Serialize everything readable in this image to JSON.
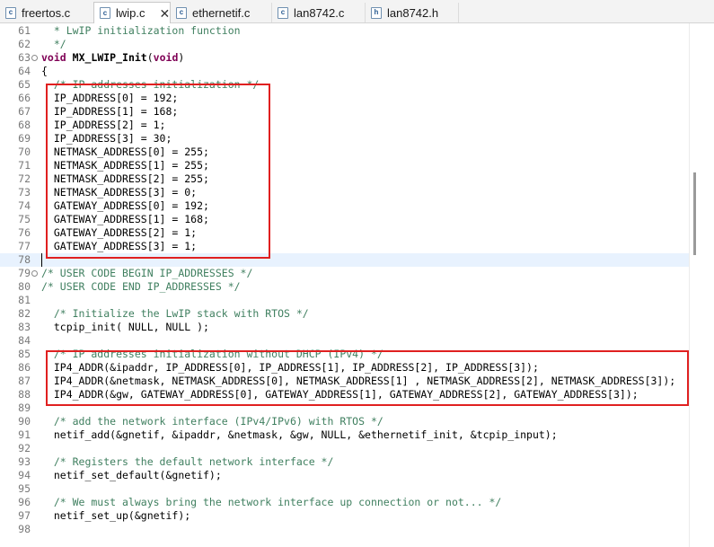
{
  "tabs": [
    {
      "label": "freertos.c",
      "icon": "c-file-icon",
      "active": false
    },
    {
      "label": "lwip.c",
      "icon": "c-file-icon",
      "active": true
    },
    {
      "label": "ethernetif.c",
      "icon": "c-file-icon",
      "active": false
    },
    {
      "label": "lan8742.c",
      "icon": "c-file-icon",
      "active": false
    },
    {
      "label": "lan8742.h",
      "icon": "h-file-icon",
      "active": false
    }
  ],
  "tab_close_glyph": "✕",
  "file_icon_letters": {
    "c": "c",
    "h": "h"
  },
  "colors": {
    "keyword": "#7f0055",
    "comment": "#3f7f5f",
    "highlight_box": "#e02020",
    "current_line": "#e8f2fe"
  },
  "editor": {
    "current_line": 78,
    "lines": [
      {
        "num": "61",
        "segs": [
          {
            "t": "  * LwIP initialization function",
            "c": "cm"
          }
        ]
      },
      {
        "num": "62",
        "segs": [
          {
            "t": "  */",
            "c": "cm"
          }
        ]
      },
      {
        "num": "63",
        "fold": true,
        "segs": [
          {
            "t": "void",
            "c": "kw"
          },
          {
            "t": " ",
            "c": ""
          },
          {
            "t": "MX_LWIP_Init",
            "c": "fn"
          },
          {
            "t": "(",
            "c": ""
          },
          {
            "t": "void",
            "c": "kw"
          },
          {
            "t": ")",
            "c": ""
          }
        ]
      },
      {
        "num": "64",
        "segs": [
          {
            "t": "{",
            "c": ""
          }
        ]
      },
      {
        "num": "65",
        "segs": [
          {
            "t": "  /* IP addresses initialization */",
            "c": "cm"
          }
        ]
      },
      {
        "num": "66",
        "segs": [
          {
            "t": "  IP_ADDRESS[0] = 192;",
            "c": ""
          }
        ]
      },
      {
        "num": "67",
        "segs": [
          {
            "t": "  IP_ADDRESS[1] = 168;",
            "c": ""
          }
        ]
      },
      {
        "num": "68",
        "segs": [
          {
            "t": "  IP_ADDRESS[2] = 1;",
            "c": ""
          }
        ]
      },
      {
        "num": "69",
        "segs": [
          {
            "t": "  IP_ADDRESS[3] = 30;",
            "c": ""
          }
        ]
      },
      {
        "num": "70",
        "segs": [
          {
            "t": "  NETMASK_ADDRESS[0] = 255;",
            "c": ""
          }
        ]
      },
      {
        "num": "71",
        "segs": [
          {
            "t": "  NETMASK_ADDRESS[1] = 255;",
            "c": ""
          }
        ]
      },
      {
        "num": "72",
        "segs": [
          {
            "t": "  NETMASK_ADDRESS[2] = 255;",
            "c": ""
          }
        ]
      },
      {
        "num": "73",
        "segs": [
          {
            "t": "  NETMASK_ADDRESS[3] = 0;",
            "c": ""
          }
        ]
      },
      {
        "num": "74",
        "segs": [
          {
            "t": "  GATEWAY_ADDRESS[0] = 192;",
            "c": ""
          }
        ]
      },
      {
        "num": "75",
        "segs": [
          {
            "t": "  GATEWAY_ADDRESS[1] = 168;",
            "c": ""
          }
        ]
      },
      {
        "num": "76",
        "segs": [
          {
            "t": "  GATEWAY_ADDRESS[2] = 1;",
            "c": ""
          }
        ]
      },
      {
        "num": "77",
        "segs": [
          {
            "t": "  GATEWAY_ADDRESS[3] = 1;",
            "c": ""
          }
        ]
      },
      {
        "num": "78",
        "segs": []
      },
      {
        "num": "79",
        "fold": true,
        "segs": [
          {
            "t": "/* USER CODE BEGIN IP_ADDRESSES */",
            "c": "cm"
          }
        ]
      },
      {
        "num": "80",
        "segs": [
          {
            "t": "/* USER CODE END IP_ADDRESSES */",
            "c": "cm"
          }
        ]
      },
      {
        "num": "81",
        "segs": []
      },
      {
        "num": "82",
        "segs": [
          {
            "t": "  /* Initialize the LwIP stack with RTOS */",
            "c": "cm"
          }
        ]
      },
      {
        "num": "83",
        "segs": [
          {
            "t": "  tcpip_init( NULL, NULL );",
            "c": ""
          }
        ]
      },
      {
        "num": "84",
        "segs": []
      },
      {
        "num": "85",
        "segs": [
          {
            "t": "  /* IP addresses initialization without DHCP (IPv4) */",
            "c": "cm"
          }
        ]
      },
      {
        "num": "86",
        "segs": [
          {
            "t": "  IP4_ADDR(&ipaddr, IP_ADDRESS[0], IP_ADDRESS[1], IP_ADDRESS[2], IP_ADDRESS[3]);",
            "c": ""
          }
        ]
      },
      {
        "num": "87",
        "segs": [
          {
            "t": "  IP4_ADDR(&netmask, NETMASK_ADDRESS[0], NETMASK_ADDRESS[1] , NETMASK_ADDRESS[2], NETMASK_ADDRESS[3]);",
            "c": ""
          }
        ]
      },
      {
        "num": "88",
        "segs": [
          {
            "t": "  IP4_ADDR(&gw, GATEWAY_ADDRESS[0], GATEWAY_ADDRESS[1], GATEWAY_ADDRESS[2], GATEWAY_ADDRESS[3]);",
            "c": ""
          }
        ]
      },
      {
        "num": "89",
        "segs": []
      },
      {
        "num": "90",
        "segs": [
          {
            "t": "  /* add the network interface (IPv4/IPv6) with RTOS */",
            "c": "cm"
          }
        ]
      },
      {
        "num": "91",
        "segs": [
          {
            "t": "  netif_add(&gnetif, &ipaddr, &netmask, &gw, NULL, &ethernetif_init, &tcpip_input);",
            "c": ""
          }
        ]
      },
      {
        "num": "92",
        "segs": []
      },
      {
        "num": "93",
        "segs": [
          {
            "t": "  /* Registers the default network interface */",
            "c": "cm"
          }
        ]
      },
      {
        "num": "94",
        "segs": [
          {
            "t": "  netif_set_default(&gnetif);",
            "c": ""
          }
        ]
      },
      {
        "num": "95",
        "segs": []
      },
      {
        "num": "96",
        "segs": [
          {
            "t": "  /* We must always bring the network interface up connection or not... */",
            "c": "cm"
          }
        ]
      },
      {
        "num": "97",
        "segs": [
          {
            "t": "  netif_set_up(&gnetif);",
            "c": ""
          }
        ]
      },
      {
        "num": "98",
        "segs": []
      }
    ]
  }
}
